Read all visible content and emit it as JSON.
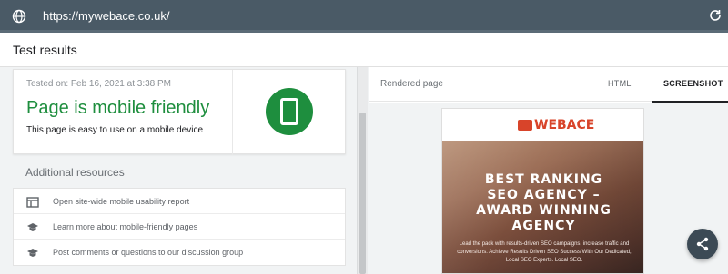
{
  "browser": {
    "url": "https://mywebace.co.uk/",
    "icons": {
      "site": "globe-icon",
      "reload": "reload-icon"
    }
  },
  "header": {
    "title": "Test results"
  },
  "result": {
    "tested_on": "Tested on: Feb 16, 2021 at 3:38 PM",
    "headline": "Page is mobile friendly",
    "subtitle": "This page is easy to use on a mobile device",
    "badge_icon": "mobile-phone-icon",
    "status_color": "#1e8e3e"
  },
  "resources": {
    "title": "Additional resources",
    "items": [
      {
        "label": "Open site-wide mobile usability report",
        "icon": "report-icon"
      },
      {
        "label": "Learn more about mobile-friendly pages",
        "icon": "school-icon"
      },
      {
        "label": "Post comments or questions to our discussion group",
        "icon": "school-icon"
      }
    ]
  },
  "preview": {
    "label": "Rendered page",
    "tabs": [
      {
        "label": "HTML",
        "active": false
      },
      {
        "label": "SCREENSHOT",
        "active": true
      }
    ],
    "site": {
      "logo": "WEBACE",
      "headline_lines": [
        "BEST RANKING",
        "SEO AGENCY –",
        "AWARD WINNING",
        "AGENCY"
      ],
      "body": "Lead the pack with results-driven SEO campaigns, increase traffic and conversions. Achieve Results Driven SEO Success With Our Dedicated, Local SEO Experts. Local SEO."
    }
  },
  "fab": {
    "icon": "share-icon"
  },
  "colors": {
    "accent_green": "#1e8e3e",
    "urlbar": "#4a5a66",
    "brand": "#d8442a"
  }
}
